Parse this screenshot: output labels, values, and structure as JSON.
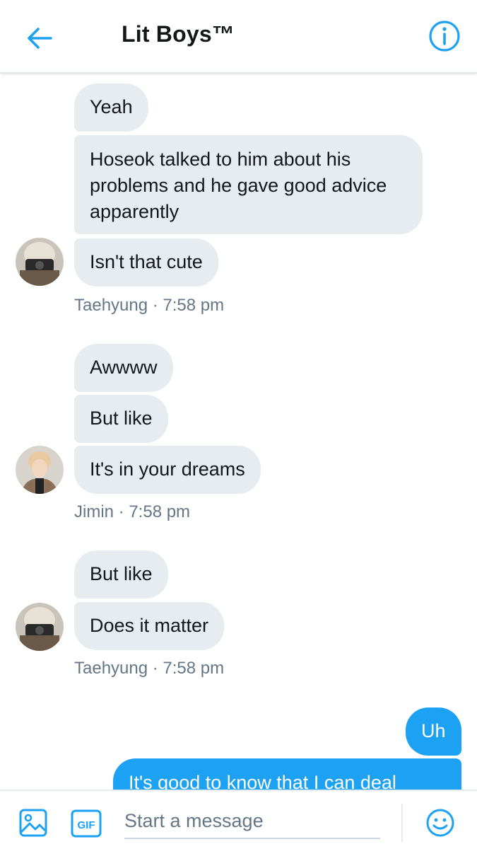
{
  "header": {
    "title": "Lit Boys™",
    "back_icon": "arrow-left-icon",
    "info_icon": "info-icon"
  },
  "messages": [
    {
      "sender": "Taehyung",
      "time": "7:58 pm",
      "meta": "Taehyung · 7:58 pm",
      "bubbles": [
        "Yeah",
        "Hoseok talked to him about his",
        "problems and he gave good advice",
        "apparently",
        "Isn't that cute"
      ]
    },
    {
      "sender": "Jimin",
      "time": "7:58 pm",
      "meta": "Jimin · 7:58 pm",
      "bubbles": [
        "Awwww",
        "But like",
        "It's in your dreams"
      ]
    },
    {
      "sender": "Taehyung",
      "time": "7:58 pm",
      "meta": "Taehyung · 7:58 pm",
      "bubbles": [
        "But like",
        "Does it matter"
      ]
    },
    {
      "sender": "me",
      "bubbles": [
        "Uh",
        "It's good to know that I can deal"
      ]
    }
  ],
  "composer": {
    "placeholder": "Start a message",
    "gif_label": "GIF",
    "media_icon": "image-icon",
    "emoji_icon": "smiley-icon"
  },
  "colors": {
    "accent": "#1da1f2",
    "incoming_bubble": "#e6ecf0",
    "meta_text": "#657786"
  }
}
